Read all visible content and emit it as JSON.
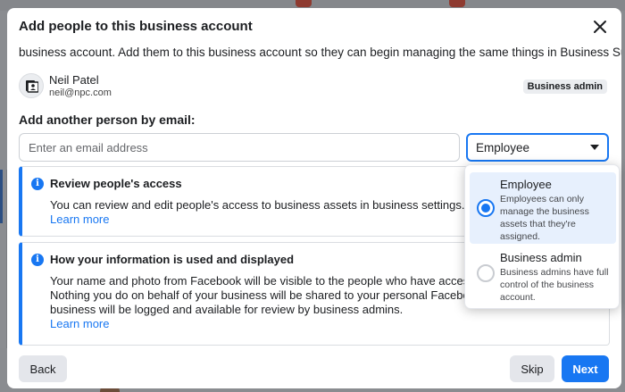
{
  "modal": {
    "title": "Add people to this business account",
    "intro": "business account. Add them to this business account so they can begin managing the same things in Business Suite."
  },
  "person": {
    "name": "Neil Patel",
    "email": "neil@npc.com",
    "role_badge": "Business admin"
  },
  "add_section": {
    "label": "Add another person by email:",
    "email_placeholder": "Enter an email address",
    "email_value": "",
    "role_selected": "Employee"
  },
  "cards": [
    {
      "title": "Review people's access",
      "lines": [
        "You can review and edit people's access to business assets in business settings."
      ],
      "link": "Learn more"
    },
    {
      "title": "How your information is used and displayed",
      "lines": [
        "Your name and photo from Facebook will be visible to the people who have access to th",
        "Nothing you do on behalf of your business will be shared to your personal Facebook. Ac",
        "business will be logged and available for review by business admins."
      ],
      "link": "Learn more"
    }
  ],
  "role_options": [
    {
      "title": "Employee",
      "description": "Employees can only manage the business assets that they're assigned.",
      "selected": true
    },
    {
      "title": "Business admin",
      "description": "Business admins have full control of the business account.",
      "selected": false
    }
  ],
  "footer": {
    "back": "Back",
    "skip": "Skip",
    "next": "Next"
  },
  "colors": {
    "accent": "#1877f2",
    "secondary_button": "#e4e6eb",
    "text": "#1c1e21"
  },
  "icons": {
    "close": "close-icon",
    "info": "info-icon",
    "person": "person-card-icon",
    "caret": "caret-down-icon"
  }
}
